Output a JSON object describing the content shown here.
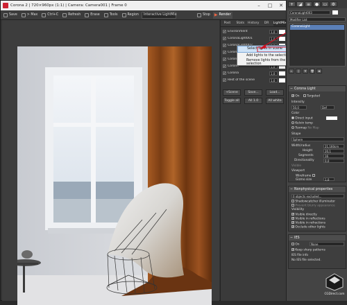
{
  "vfb": {
    "title": "Corona 2 | 720×960px (1:1) | Camera: Camera001 | Frame 0",
    "toolbar": {
      "save": "Save",
      "to_max": "> Max",
      "ctrl_c": "Ctrl+C",
      "refresh": "Refresh",
      "erase": "Erase",
      "tools": "Tools",
      "region": "Region",
      "mode": "Interactive LightMix",
      "stop": "Stop",
      "render": "Render"
    }
  },
  "panel": {
    "tabs": [
      "Post",
      "Stats",
      "History",
      "DR",
      "LightMix"
    ],
    "active_tab": "LightMix",
    "lights": [
      {
        "name": "Environment",
        "value": "1,0"
      },
      {
        "name": "CoronaLight001",
        "value": "1,0"
      },
      {
        "name": "CoronaLight002",
        "value": "1,0"
      },
      {
        "name": "Corona",
        "value": "1,0"
      },
      {
        "name": "Corona",
        "value": "1,0"
      },
      {
        "name": "Corona",
        "value": "1,0"
      },
      {
        "name": "Corona",
        "value": "1,0"
      },
      {
        "name": "Rest of the scene",
        "value": "1,0"
      }
    ],
    "buttons": {
      "scene": "+Scene",
      "save": "Save...",
      "load": "Load...",
      "toggle_all": "Toggle all",
      "all": "All 1.0",
      "all_white": "All white"
    }
  },
  "context_menu": {
    "items": [
      "Select lights in scene",
      "Add lights to the selection",
      "Remove lights from the selection"
    ],
    "highlighted": "Select lights in scene"
  },
  "max_panel": {
    "object_name": "CoronaLight003",
    "modifier_list": "Modifier List",
    "stack_item": "CoronaLight",
    "corona_light": {
      "header": "Corona Light",
      "on": "On",
      "targeted": "Targeted",
      "intensity_label": "Intensity",
      "intensity": "50,0",
      "unit": "Def",
      "color_label": "Color",
      "direct_input": "Direct input",
      "kelvin_temp": "Kelvin temp",
      "texmap": "Texmap",
      "texmap_value": "No Map",
      "shape_label": "Shape",
      "shape": "Sphere",
      "width_radius_label": "Width/radius",
      "width_radius": "21,160cm",
      "height_label": "Height",
      "height": "20,1",
      "segments_label": "Segments",
      "segments": "16",
      "directionality_label": "Directionality",
      "directionality": "0,0",
      "visible_label": "Visible",
      "viewport_label": "Viewport",
      "wireframe_label": "Wireframe",
      "gizmo_size_label": "Gizmo size",
      "gizmo_size": "1,0"
    },
    "nonphysical": {
      "header": "Nonphysical properties",
      "excluded": "0 objects excluded...",
      "shadowcatcher": "Shadowcatcher illuminator",
      "prevent": "Prevent blurry appearance",
      "visibility_label": "Visibility",
      "checks": [
        "Visible directly",
        "Visible in reflections",
        "Visible in refractions",
        "Occlude other lights"
      ]
    },
    "ies": {
      "header": "IES",
      "on": "On",
      "file": "None",
      "keep_sharp": "Keep sharp patterns",
      "info_label": "IES file info",
      "info": "No IES file selected."
    }
  },
  "watermark": "CGDirect.com"
}
